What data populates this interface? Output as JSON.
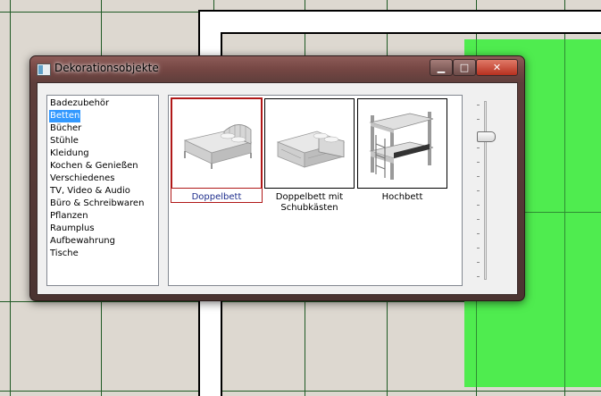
{
  "dialog": {
    "title": "Dekorationsobjekte",
    "close_glyph": "✕",
    "minimize_glyph": "▁",
    "maximize_glyph": "□"
  },
  "categories": [
    "Badezubehör",
    "Betten",
    "Bücher",
    "Stühle",
    "Kleidung",
    "Kochen & Genießen",
    "Verschiedenes",
    "TV, Video & Audio",
    "Büro & Schreibwaren",
    "Pflanzen",
    "Raumplus",
    "Aufbewahrung",
    "Tische"
  ],
  "selected_category": "Betten",
  "items": [
    {
      "label": "Doppelbett",
      "icon": "double-bed",
      "selected": true
    },
    {
      "label": "Doppelbett mit Schubkästen",
      "icon": "double-bed-drawers",
      "selected": false
    },
    {
      "label": "Hochbett",
      "icon": "bunk-bed",
      "selected": false
    }
  ],
  "size_slider": {
    "level": 0.18
  },
  "colors": {
    "title_bar": "#764744",
    "selection": "#3399ff",
    "selected_item_border": "#b01818",
    "floor_zone": "#4fec4f",
    "grid": "#1f5a24"
  }
}
